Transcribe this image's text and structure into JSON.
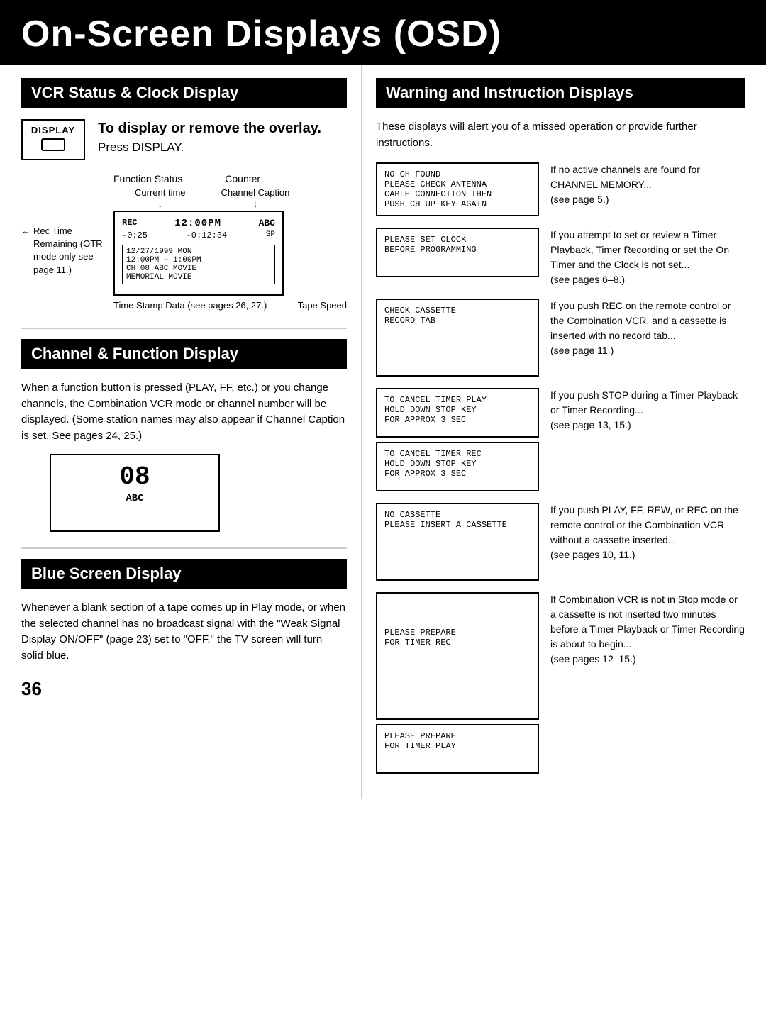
{
  "page": {
    "title": "On-Screen Displays (OSD)",
    "number": "36"
  },
  "vcr_status": {
    "section_title": "VCR Status & Clock Display",
    "display_key_label": "DISPLAY",
    "instruction_bold": "To display or remove the overlay.",
    "instruction_press": "Press DISPLAY.",
    "diagram": {
      "function_status_label": "Function Status",
      "counter_label": "Counter",
      "current_time_label": "Current time",
      "channel_caption_label": "Channel Caption",
      "rec_label": "REC",
      "time": "12:00PM",
      "ch_caption": "ABC",
      "rec_remaining_label": "-0:25",
      "counter": "-0:12:34",
      "sp": "SP",
      "bottom_line1": "12/27/1999 MON",
      "bottom_line2": "12:00PM – 1:00PM",
      "bottom_line3": "CH 08 ABC MOVIE",
      "bottom_line4": "MEMORIAL MOVIE",
      "rec_time_remaining": "Rec Time Remaining (OTR mode only see page 11.)",
      "time_stamp_label": "Time Stamp Data (see pages 26, 27.)",
      "tape_speed_label": "Tape Speed"
    }
  },
  "channel_function": {
    "section_title": "Channel & Function Display",
    "body_text": "When a function button is pressed (PLAY, FF, etc.) or you change channels, the Combination VCR mode or channel number will be displayed.\n(Some station names may also appear if Channel Caption is set. See pages 24, 25.)",
    "display_ch": "08",
    "display_abc": "ABC"
  },
  "blue_screen": {
    "section_title": "Blue Screen Display",
    "body_text": "Whenever a blank section of a tape comes up in Play mode, or when the selected channel has no broadcast signal with the \"Weak Signal Display ON/OFF\" (page 23) set to \"OFF,\" the TV screen will turn solid blue."
  },
  "warning": {
    "section_title": "Warning and Instruction Displays",
    "intro": "These displays will alert you of a missed operation or provide further instructions.",
    "items": [
      {
        "screen_lines": [
          "NO CH FOUND",
          "PLEASE CHECK ANTENNA",
          "CABLE CONNECTION THEN",
          "PUSH CH UP KEY AGAIN"
        ],
        "description": "If no active channels are found for CHANNEL MEMORY...\n(see page 5.)"
      },
      {
        "screen_lines": [
          "PLEASE SET CLOCK",
          "BEFORE PROGRAMMING"
        ],
        "description": "If you attempt to set or review a Timer Playback, Timer Recording or set the On Timer and the Clock is not set...\n(see pages 6–8.)"
      },
      {
        "screen_lines": [
          "CHECK CASSETTE",
          "RECORD TAB"
        ],
        "description": "If you push REC on the remote control or the Combination VCR, and a cassette is inserted with no record tab...\n(see page 11.)"
      },
      {
        "screen_lines": [
          "TO CANCEL TIMER PLAY",
          "HOLD DOWN STOP KEY",
          "FOR APPROX 3 SEC",
          "",
          "TO CANCEL TIMER REC",
          "HOLD DOWN STOP KEY",
          "FOR APPROX 3 SEC"
        ],
        "description": "If you push STOP during a Timer Playback or Timer Recording...\n(see page 13, 15.)"
      },
      {
        "screen_lines": [
          "NO CASSETTE",
          "PLEASE INSERT A CASSETTE"
        ],
        "description": "If you push PLAY, FF, REW, or REC on the remote control or the Combination VCR without a cassette inserted...\n(see pages 10, 11.)"
      },
      {
        "screen_lines": [
          "PLEASE PREPARE",
          "FOR TIMER REC",
          "",
          "PLEASE PREPARE",
          "FOR TIMER PLAY"
        ],
        "description": "If Combination VCR is not in Stop mode or a cassette is not inserted two minutes before a Timer Playback or Timer Recording is about to begin...\n(see pages 12–15.)"
      }
    ]
  }
}
